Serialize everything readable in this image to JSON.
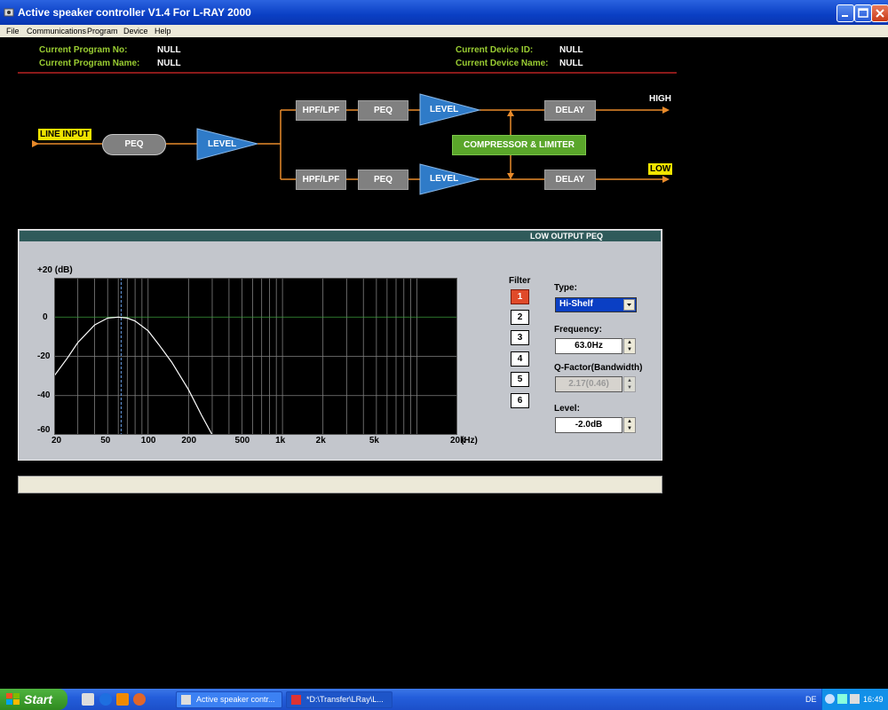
{
  "window": {
    "title": "Active speaker controller V1.4 For L-RAY 2000"
  },
  "menu": [
    "File",
    "Communications",
    "Program",
    "Device",
    "Help"
  ],
  "info": {
    "program_no_label": "Current Program No:",
    "program_no_value": "NULL",
    "program_name_label": "Current Program Name:",
    "program_name_value": "NULL",
    "device_id_label": "Current Device ID:",
    "device_id_value": "NULL",
    "device_name_label": "Current Device Name:",
    "device_name_value": "NULL"
  },
  "diagram": {
    "line_input": "LINE INPUT",
    "peq": "PEQ",
    "level": "LEVEL",
    "hpf_lpf": "HPF/LPF",
    "delay": "DELAY",
    "compressor": "COMPRESSOR & LIMITER",
    "high": "HIGH",
    "low": "LOW"
  },
  "peq_panel": {
    "title": "LOW OUTPUT PEQ",
    "y_unit_label": "+20 (dB)",
    "y_ticks": [
      "0",
      "-20",
      "-40",
      "-60"
    ],
    "x_ticks": [
      "20",
      "50",
      "100",
      "200",
      "500",
      "1k",
      "2k",
      "5k",
      "20k"
    ],
    "x_unit": "(Hz)",
    "filter_label": "Filter",
    "filters": [
      "1",
      "2",
      "3",
      "4",
      "5",
      "6"
    ],
    "active_filter": 1,
    "type_label": "Type:",
    "type_value": "Hi-Shelf",
    "frequency_label": "Frequency:",
    "frequency_value": "63.0Hz",
    "q_label": "Q-Factor(Bandwidth)",
    "q_value": "2.17(0.46)",
    "level_label": "Level:",
    "level_value": "-2.0dB",
    "colors": {
      "panel": "#c3c6cc",
      "graph_bg": "#000000",
      "curve": "#ffffff",
      "grid": "#808080",
      "zero_line": "#3a9a3a",
      "marker": "#6aa0e8"
    }
  },
  "chart_data": {
    "type": "line",
    "xscale": "log",
    "xlim": [
      20,
      20000
    ],
    "ylim": [
      -60,
      20
    ],
    "y_ticks": [
      0,
      -20,
      -40,
      -60
    ],
    "x_ticks": [
      20,
      50,
      100,
      200,
      500,
      1000,
      2000,
      5000,
      20000
    ],
    "series": [
      {
        "x": [
          20,
          25,
          30,
          40,
          50,
          60,
          70,
          80,
          100,
          120,
          150,
          200,
          250,
          300
        ],
        "y": [
          -30,
          -21,
          -13,
          -4,
          -0.5,
          0,
          -0.5,
          -2,
          -7,
          -14,
          -23,
          -37,
          -50,
          -60
        ]
      }
    ],
    "marker_frequency_hz": 63,
    "grid": true
  },
  "taskbar": {
    "start": "Start",
    "task1": "Active speaker contr...",
    "task2": "*D:\\Transfer\\LRay\\L...",
    "lang": "DE",
    "time": "16:49"
  }
}
